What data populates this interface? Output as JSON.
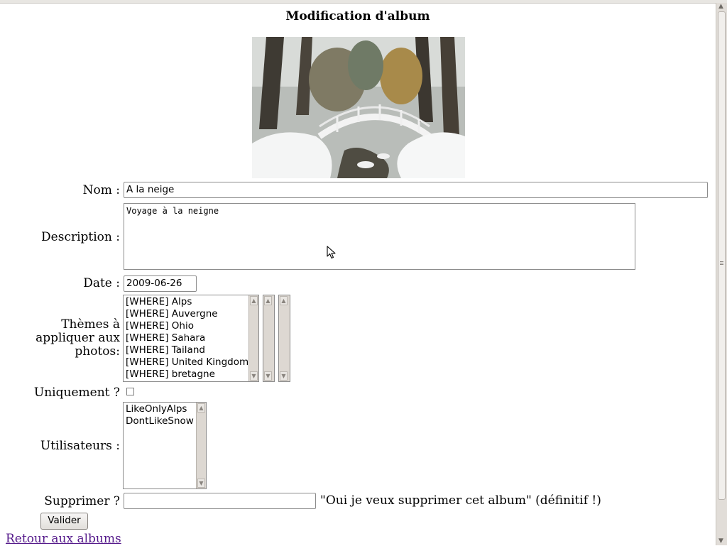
{
  "title": "Modification d'album",
  "form": {
    "nom_label": "Nom :",
    "nom_value": "A la neige",
    "description_label": "Description :",
    "description_value": "Voyage à la neigne",
    "date_label": "Date :",
    "date_value": "2009-06-26",
    "themes_label_1": "Thèmes à",
    "themes_label_2": "appliquer aux",
    "themes_label_3": "photos:",
    "themes_options": [
      "[WHERE] Alps",
      "[WHERE] Auvergne",
      "[WHERE] Ohio",
      "[WHERE] Sahara",
      "[WHERE] Tailand",
      "[WHERE] United Kingdom",
      "[WHERE] bretagne"
    ],
    "uniquement_label": "Uniquement ?",
    "utilisateurs_label": "Utilisateurs :",
    "users_options": [
      "LikeOnlyAlps",
      "DontLikeSnow"
    ],
    "supprimer_label": "Supprimer ?",
    "supprimer_value": "",
    "supprimer_hint": "\"Oui je veux supprimer cet album\" (définitif !)",
    "submit_label": "Valider"
  },
  "back_link": "Retour aux albums",
  "icons": {
    "scroll_up": "chevron-up-icon",
    "scroll_down": "chevron-down-icon"
  }
}
